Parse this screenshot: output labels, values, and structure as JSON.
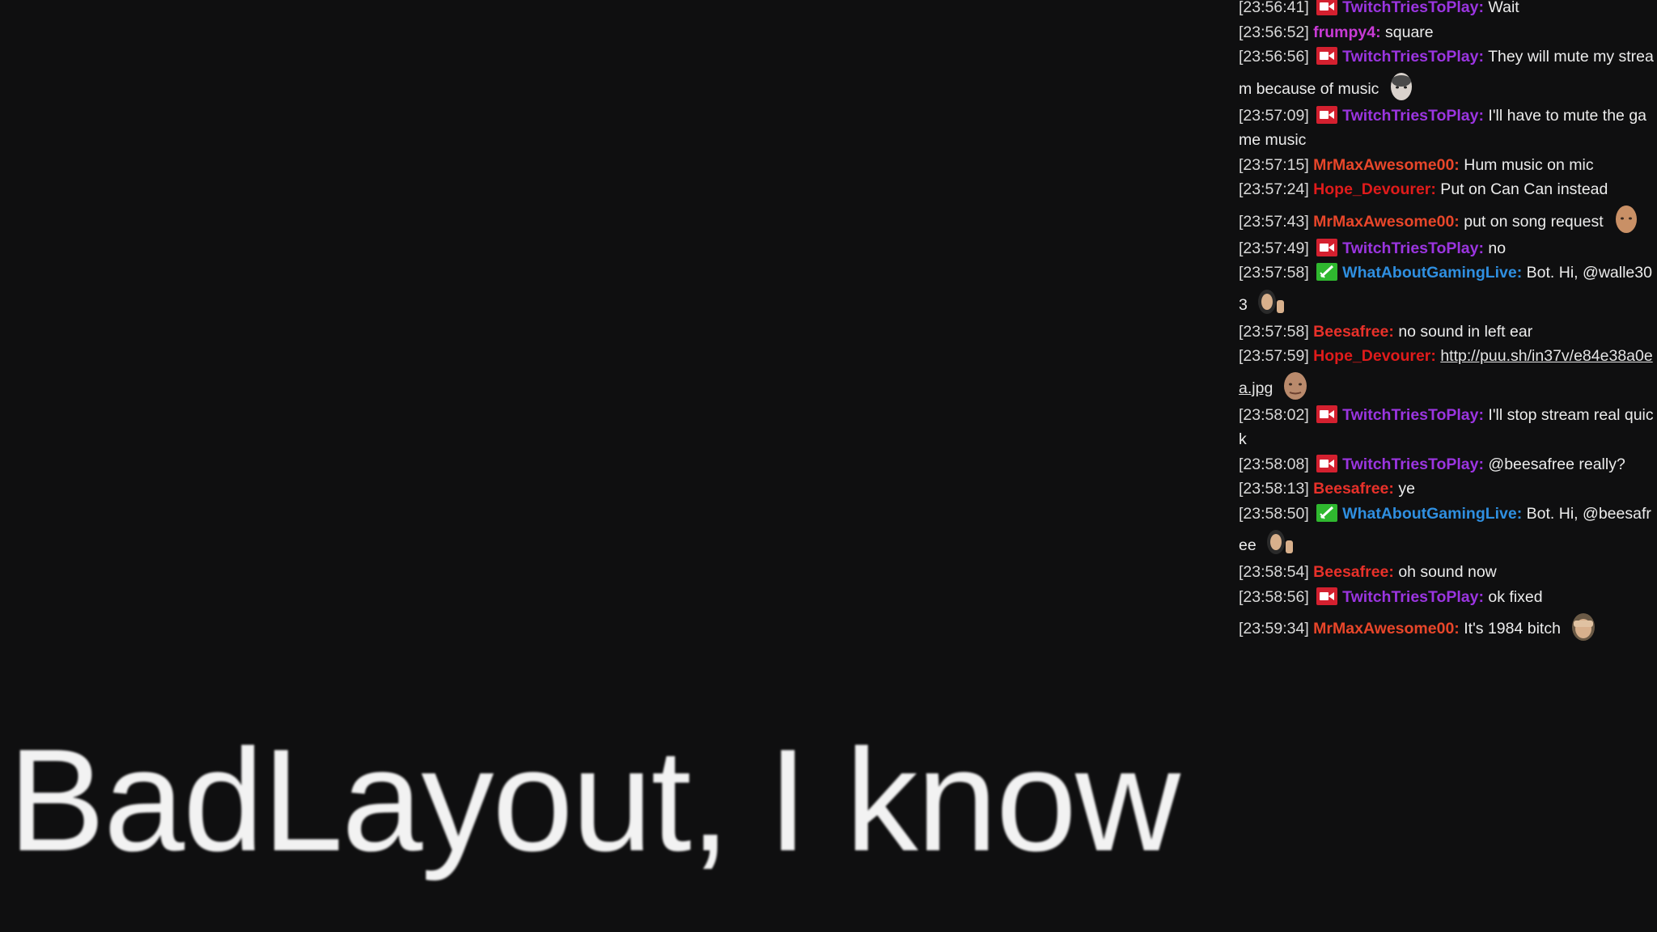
{
  "colors": {
    "background": "#0f0f10",
    "caster": "#9b35e0",
    "frumpy4": "#c93bd6",
    "MrMaxAwesome00": "#e8462a",
    "Hope_Devourer": "#e01b1b",
    "WhatAboutGamingLive": "#2f8fe0",
    "Beesafree": "#e8312a",
    "caster_badge": "#d4202f",
    "mod_badge": "#2fb82f"
  },
  "chat": {
    "messages": [
      {
        "time": "[23:56:41]",
        "user": "TwitchTriesToPlay:",
        "color": "#9b35e0",
        "badge": "camera-badge-icon",
        "text": " Wait",
        "emote": ""
      },
      {
        "time": "[23:56:52]",
        "user": "frumpy4:",
        "color": "#c93bd6",
        "badge": "",
        "text": " square",
        "emote": ""
      },
      {
        "time": "[23:56:56]",
        "user": "TwitchTriesToPlay:",
        "color": "#9b35e0",
        "badge": "camera-badge-icon",
        "text": " They will mute my stream because of music",
        "emote": "face-emote-icon"
      },
      {
        "time": "[23:57:09]",
        "user": "TwitchTriesToPlay:",
        "color": "#9b35e0",
        "badge": "camera-badge-icon",
        "text": " I'll have to mute the game music",
        "emote": ""
      },
      {
        "time": "[23:57:15]",
        "user": "MrMaxAwesome00:",
        "color": "#e8462a",
        "badge": "",
        "text": " Hum music on mic",
        "emote": ""
      },
      {
        "time": "[23:57:24]",
        "user": "Hope_Devourer:",
        "color": "#e01b1b",
        "badge": "",
        "text": " Put on Can Can instead",
        "emote": ""
      },
      {
        "time": "[23:57:43]",
        "user": "MrMaxAwesome00:",
        "color": "#e8462a",
        "badge": "",
        "text": " put on song request",
        "emote": "bald-face-emote-icon"
      },
      {
        "time": "[23:57:49]",
        "user": "TwitchTriesToPlay:",
        "color": "#9b35e0",
        "badge": "camera-badge-icon",
        "text": " no",
        "emote": ""
      },
      {
        "time": "[23:57:58]",
        "user": "WhatAboutGamingLive:",
        "color": "#2f8fe0",
        "badge": "sword-badge-icon",
        "text": " Bot. Hi, @walle303",
        "emote": "wave-emote-icon"
      },
      {
        "time": "[23:57:58]",
        "user": "Beesafree:",
        "color": "#e8312a",
        "badge": "",
        "text": " no sound in left ear",
        "emote": ""
      },
      {
        "time": "[23:57:59]",
        "user": "Hope_Devourer:",
        "color": "#e01b1b",
        "badge": "",
        "text": "",
        "link": "http://puu.sh/in37v/e84e38a0ea.jpg",
        "emote": "kappa-face-emote-icon"
      },
      {
        "time": "[23:58:02]",
        "user": "TwitchTriesToPlay:",
        "color": "#9b35e0",
        "badge": "camera-badge-icon",
        "text": " I'll stop stream real quick",
        "emote": ""
      },
      {
        "time": "[23:58:08]",
        "user": "TwitchTriesToPlay:",
        "color": "#9b35e0",
        "badge": "camera-badge-icon",
        "text": " @beesafree really?",
        "emote": ""
      },
      {
        "time": "[23:58:13]",
        "user": "Beesafree:",
        "color": "#e8312a",
        "badge": "",
        "text": " ye",
        "emote": ""
      },
      {
        "time": "[23:58:50]",
        "user": "WhatAboutGamingLive:",
        "color": "#2f8fe0",
        "badge": "sword-badge-icon",
        "text": " Bot. Hi, @beesafree",
        "emote": "wave-emote-icon"
      },
      {
        "time": "[23:58:54]",
        "user": "Beesafree:",
        "color": "#e8312a",
        "badge": "",
        "text": " oh sound now",
        "emote": ""
      },
      {
        "time": "[23:58:56]",
        "user": "TwitchTriesToPlay:",
        "color": "#9b35e0",
        "badge": "camera-badge-icon",
        "text": " ok fixed",
        "emote": ""
      },
      {
        "time": "[23:59:34]",
        "user": "MrMaxAwesome00:",
        "color": "#e8462a",
        "badge": "",
        "text": " It's 1984 bitch",
        "emote": "facepalm-emote-icon"
      }
    ]
  },
  "banner": {
    "text": "BadLayout, I know"
  }
}
